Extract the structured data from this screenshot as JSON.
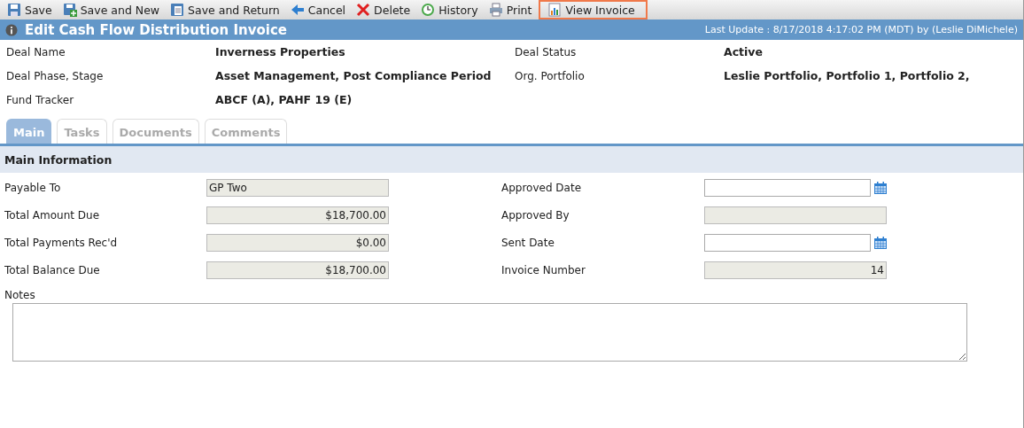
{
  "toolbar": [
    {
      "label": "Save",
      "highlighted": false
    },
    {
      "label": "Save and New",
      "highlighted": false
    },
    {
      "label": "Save and Return",
      "highlighted": false
    },
    {
      "label": "Cancel",
      "highlighted": false
    },
    {
      "label": "Delete",
      "highlighted": false
    },
    {
      "label": "History",
      "highlighted": false
    },
    {
      "label": "Print",
      "highlighted": false
    },
    {
      "label": "View Invoice",
      "highlighted": true
    }
  ],
  "title_bar": {
    "title": "Edit Cash Flow Distribution Invoice",
    "last_update": "Last Update : 8/17/2018 4:17:02 PM (MDT) by (Leslie DiMichele)"
  },
  "deal_info": [
    {
      "label": "Deal Name",
      "value": "Inverness Properties"
    },
    {
      "label": "Deal Status",
      "value": "Active"
    },
    {
      "label": "Deal Phase, Stage",
      "value": "Asset Management, Post Compliance Period"
    },
    {
      "label": "Org. Portfolio",
      "value": "Leslie Portfolio, Portfolio 1, Portfolio 2,"
    },
    {
      "label": "Fund Tracker",
      "value": "ABCF (A), PAHF 19 (E)"
    }
  ],
  "tabs": [
    {
      "label": "Main",
      "selected": true
    },
    {
      "label": "Tasks",
      "selected": false
    },
    {
      "label": "Documents",
      "selected": false
    },
    {
      "label": "Comments",
      "selected": false
    }
  ],
  "section": {
    "title": "Main Information"
  },
  "fields": [
    {
      "label": "Payable To",
      "kind": "text",
      "value": "GP Two"
    },
    {
      "label": "Approved Date",
      "kind": "date"
    },
    {
      "label": "Total Amount Due",
      "kind": "amount",
      "value": "$18,700.00"
    },
    {
      "label": "Approved By",
      "kind": "text"
    },
    {
      "label": "Total Payments Rec'd",
      "kind": "amount",
      "value": "$0.00"
    },
    {
      "label": "Sent Date",
      "kind": "date"
    },
    {
      "label": "Total Balance Due",
      "kind": "amount",
      "value": "$18,700.00"
    },
    {
      "label": "Invoice Number",
      "kind": "amount",
      "value": "14"
    }
  ],
  "notes": {
    "label": "Notes"
  }
}
